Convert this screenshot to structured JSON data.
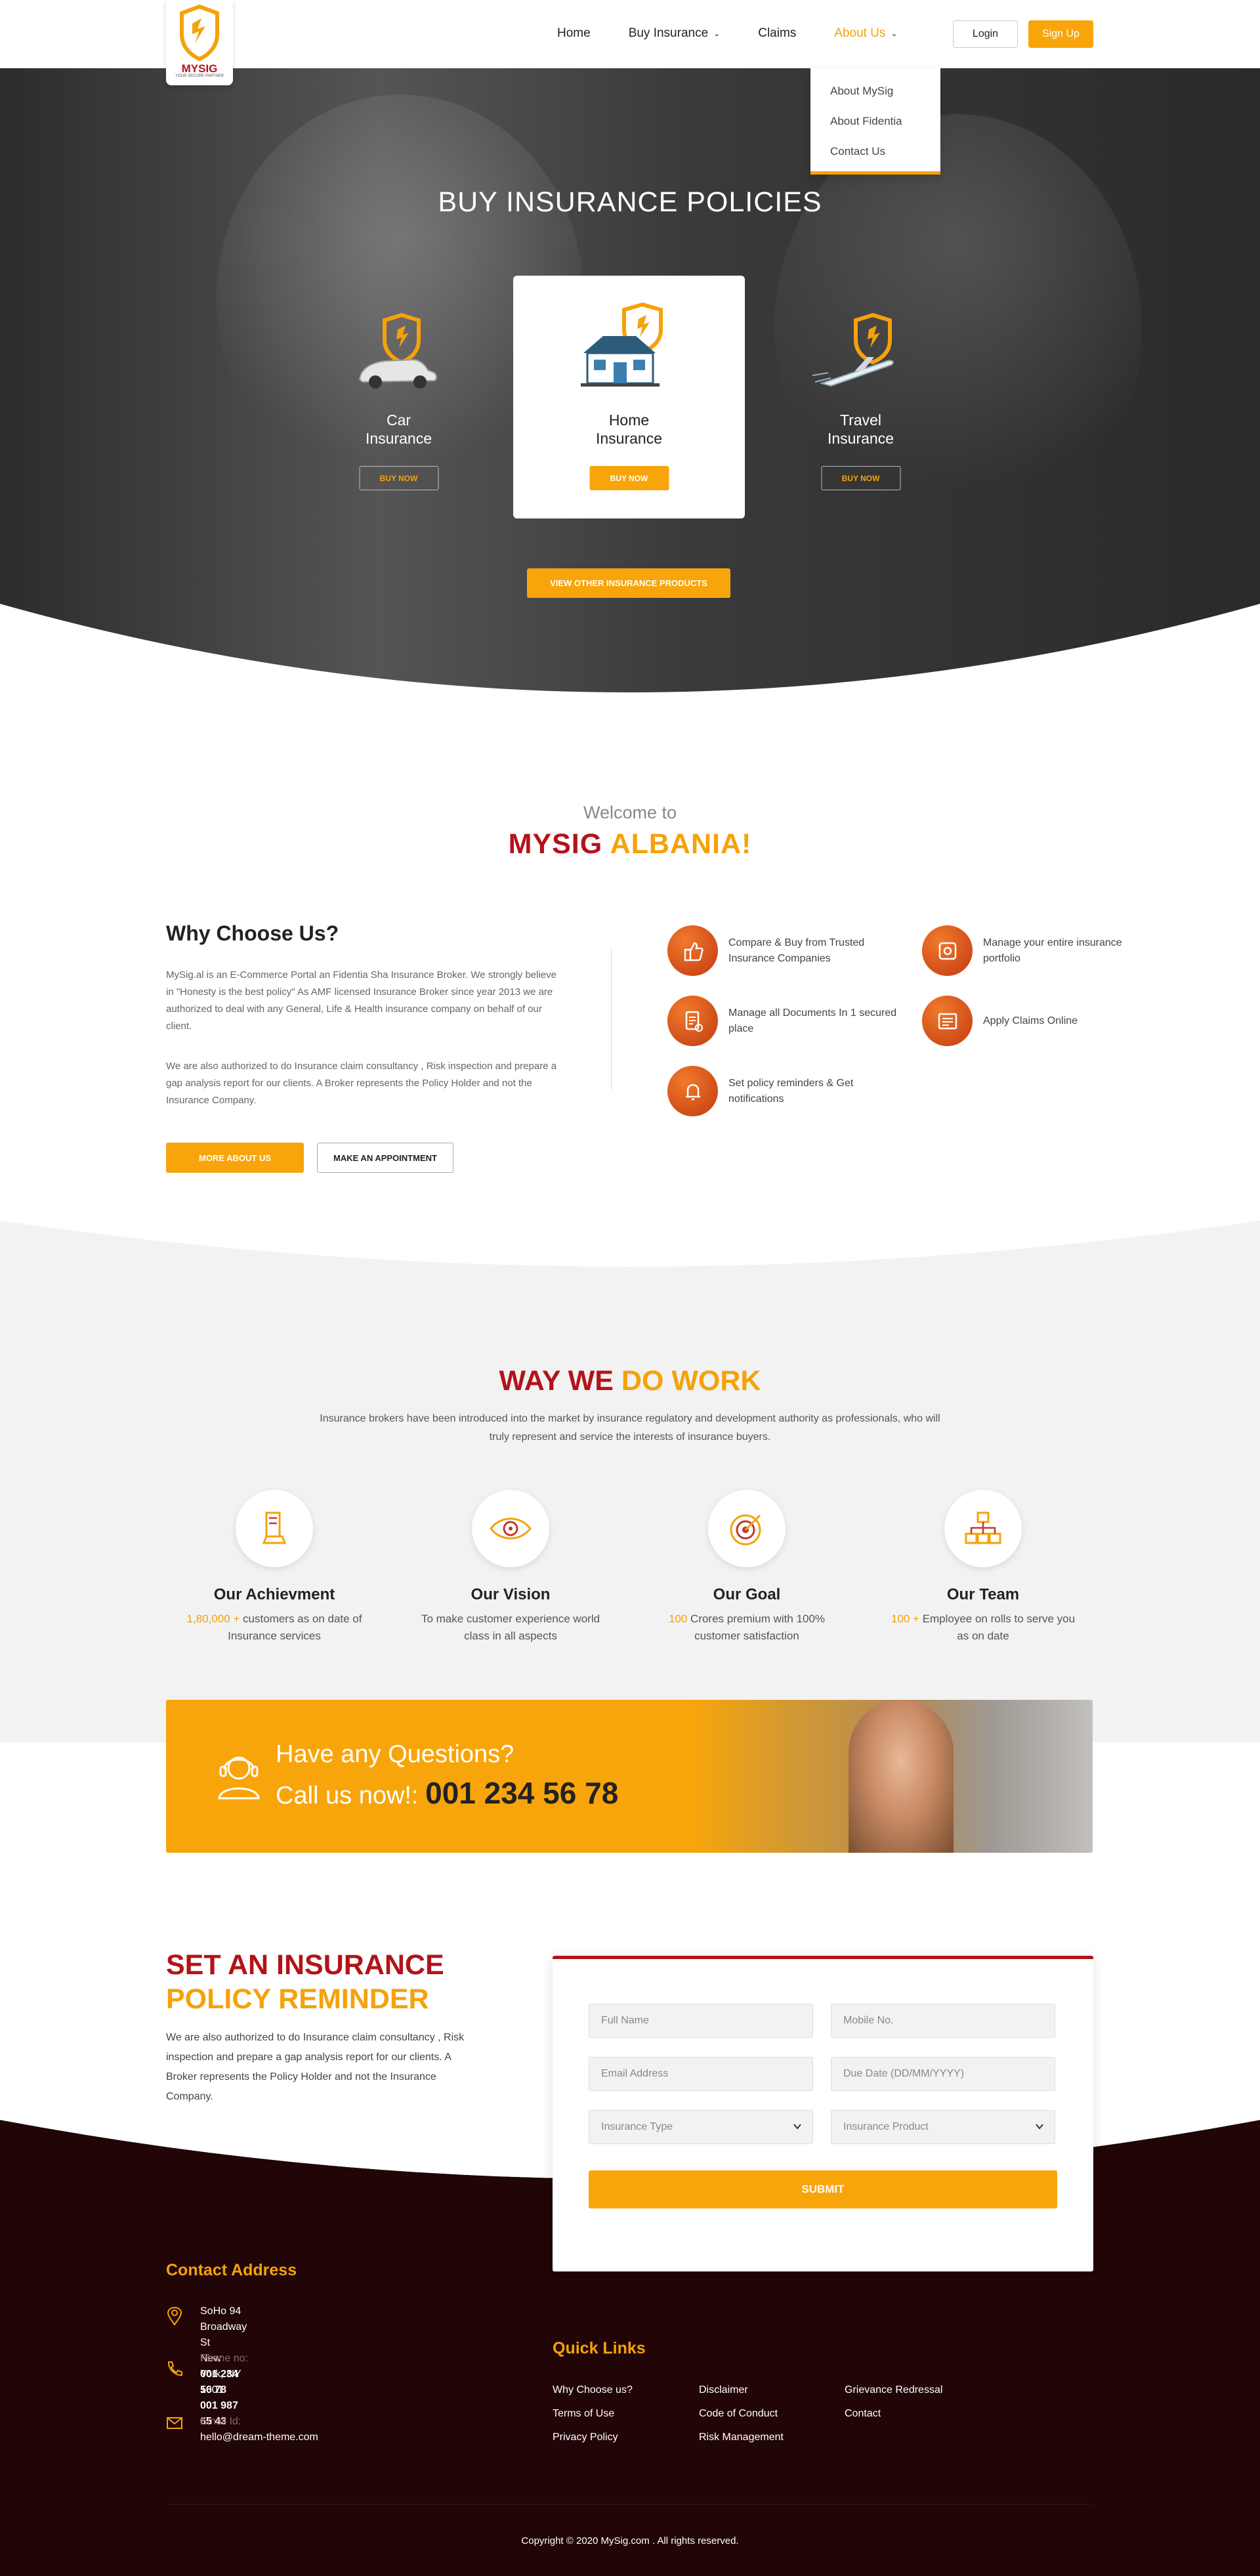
{
  "header": {
    "logo_text": "MYSIG",
    "logo_sub": "YOUR SECURE PARTNER",
    "nav": [
      "Home",
      "Buy Insurance",
      "Claims",
      "About Us"
    ],
    "login": "Login",
    "signup": "Sign Up",
    "about_menu": [
      "About MySig",
      "About Fidentia",
      "Contact Us"
    ]
  },
  "hero": {
    "title": "BUY INSURANCE POLICIES",
    "products": [
      {
        "name": "Car\nInsurance",
        "button": "BUY NOW"
      },
      {
        "name": "Home\nInsurance",
        "button": "BUY NOW"
      },
      {
        "name": "Travel\nInsurance",
        "button": "BUY NOW"
      }
    ],
    "other_button": "VIEW OTHER INSURANCE PRODUCTS"
  },
  "welcome": {
    "line1": "Welcome to",
    "line2a": "MYSIG",
    "line2b": "ALBANIA!"
  },
  "why": {
    "title": "Why Choose Us?",
    "p1": "MySig.al is an E-Commerce Portal an Fidentia Sha Insurance Broker. We strongly believe in \"Honesty is the best policy\" As AMF licensed Insurance Broker since year 2013 we are authorized to deal with any General, Life & Health insurance company on behalf of our client.",
    "p2": "We are also authorized to do Insurance claim consultancy , Risk inspection and prepare a gap analysis report for our clients. A Broker represents the Policy Holder and not the Insurance Company.",
    "more_button": "MORE ABOUT US",
    "appt_button": "MAKE AN APPOINTMENT",
    "features": [
      "Compare & Buy from Trusted Insurance Companies",
      "Manage your entire insurance portfolio",
      "Manage all Documents In 1 secured place",
      "Apply Claims Online",
      "Set policy reminders & Get notifications"
    ]
  },
  "work": {
    "title_a": "WAY WE",
    "title_b": "DO WORK",
    "subtitle": "Insurance brokers have been introduced into the market by insurance regulatory and development authority as professionals, who will truly represent and service the interests of insurance buyers.",
    "items": [
      {
        "title": "Our Achievment",
        "hl": "1,80,000 +",
        "desc": " customers as on date of Insurance services"
      },
      {
        "title": "Our Vision",
        "hl": "",
        "desc": "To make customer experience world class in all aspects"
      },
      {
        "title": "Our Goal",
        "hl": "100",
        "desc": " Crores premium with 100% customer satisfaction"
      },
      {
        "title": "Our Team",
        "hl": "100 +",
        "desc": " Employee on rolls to serve you as on date"
      }
    ]
  },
  "questions": {
    "line1": "Have any Questions?",
    "line2": "Call us now!:",
    "phone": "001 234 56 78"
  },
  "reminder": {
    "title_a": "SET AN INSURANCE",
    "title_b": "POLICY REMINDER",
    "text": "We are also authorized to do Insurance claim consultancy , Risk inspection and prepare a gap analysis report for our clients. A Broker represents the Policy Holder and not the Insurance Company.",
    "fields": {
      "name": "Full Name",
      "mobile": "Mobile No.",
      "email": "Email Address",
      "due": "Due Date (DD/MM/YYYY)",
      "type": "Insurance Type",
      "product": "Insurance Product"
    },
    "submit": "SUBMIT"
  },
  "footer": {
    "contact_title": "Contact Address",
    "address": "SoHo 94 Broadway St\nNew York, NY 1001",
    "phone_label": "Phone no:",
    "phones": "001 234 56 78\n001 987 65 43",
    "email_label": "Email Id:",
    "email": "hello@dream-theme.com",
    "quick_title": "Quick Links",
    "links_col1": [
      "Why Choose us?",
      "Terms of Use",
      "Privacy Policy"
    ],
    "links_col2": [
      "Disclaimer",
      "Code of Conduct",
      "Risk Management"
    ],
    "links_col3": [
      "Grievance Redressal",
      "Contact"
    ],
    "copyright": "Copyright © 2020 MySig.com . All rights reserved."
  },
  "colors": {
    "accent": "#f8a50b",
    "brand_red": "#b31318",
    "footer_bg": "#210507"
  }
}
